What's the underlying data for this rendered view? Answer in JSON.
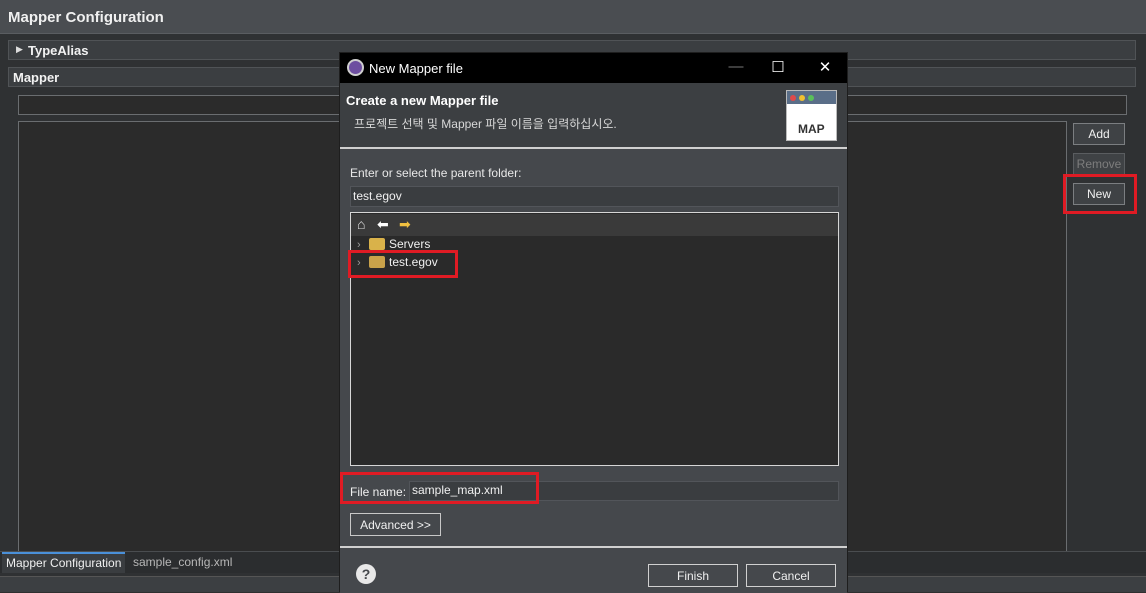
{
  "editor": {
    "title": "Mapper Configuration",
    "typealias_label": "TypeAlias",
    "mapper_label": "Mapper",
    "buttons": {
      "add": "Add",
      "remove": "Remove",
      "new": "New"
    }
  },
  "bottom_tabs": {
    "mapper": "Mapper Configuration",
    "sample": "sample_config.xml"
  },
  "dialog": {
    "title": "New Mapper file",
    "banner_title": "Create a new Mapper file",
    "banner_desc": "프로젝트 선택 및 Mapper 파일 이름을 입력하십시오.",
    "map_icon_label": "MAP",
    "parent_label": "Enter or select the parent folder:",
    "parent_value": "test.egov",
    "tree_items": [
      {
        "label": "Servers"
      },
      {
        "label": "test.egov"
      }
    ],
    "filename_label": "File name:",
    "filename_value": "sample_map.xml",
    "advanced_label": "Advanced >>",
    "finish_label": "Finish",
    "cancel_label": "Cancel",
    "help_symbol": "?"
  },
  "icons": [
    "gear-icon",
    "minimize-icon",
    "maximize-icon",
    "close-icon",
    "home-icon",
    "back-arrow-icon",
    "forward-arrow-icon",
    "folder-icon",
    "project-icon",
    "help-icon",
    "triangle-right-icon"
  ],
  "colors": {
    "highlight": "#e01b24",
    "dialog_bg": "#45484c",
    "titlebar": "#000000"
  }
}
